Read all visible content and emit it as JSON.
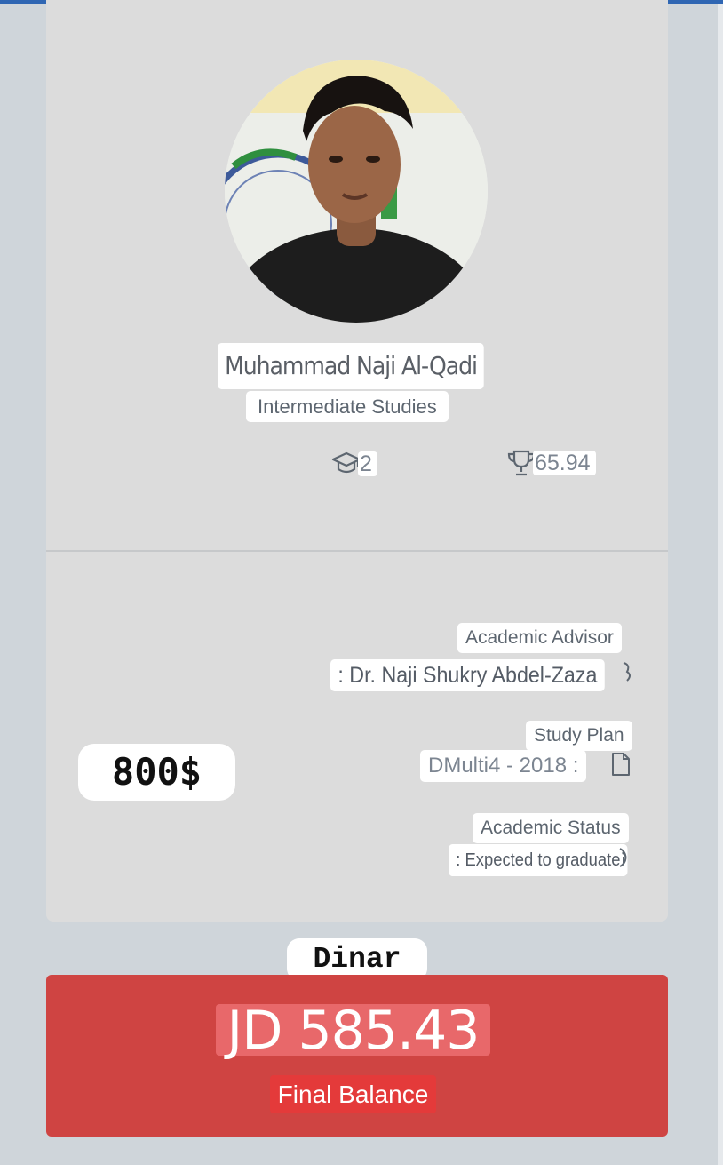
{
  "profile": {
    "name": "Muhammad Naji Al-Qadi",
    "program": "Intermediate Studies"
  },
  "stats": {
    "level_icon": "graduation-cap-icon",
    "level_value": "2",
    "gpa_icon": "trophy-icon",
    "gpa_value": "65.94"
  },
  "details": {
    "advisor_label": "Academic Advisor",
    "advisor_value": ": Dr. Naji Shukry Abdel-Zaza",
    "study_plan_label": "Study Plan",
    "study_plan_value": "DMulti4 - 2018 :",
    "status_label": "Academic Status",
    "status_value": ": Expected to graduate"
  },
  "overlay": {
    "amount": "800$",
    "currency": "Dinar"
  },
  "balance": {
    "amount": "JD 585.43",
    "label": "Final Balance"
  },
  "colors": {
    "top_bar": "#2f66b3",
    "card_bg": "#dcdcdc",
    "balance_bg": "#cf4442"
  }
}
